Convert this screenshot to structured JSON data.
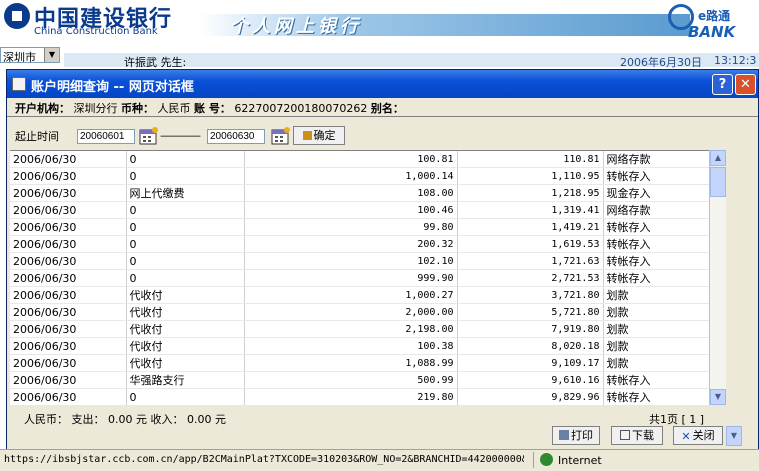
{
  "banner": {
    "bank_name": "中国建设银行",
    "bank_name_en": "China Construction Bank",
    "slogan": "个人网上银行",
    "ebank_cn": "e路通",
    "ebank_en": "BANK"
  },
  "location": {
    "city": "深圳市"
  },
  "user": {
    "name": "许振武 先生:",
    "date": "2006年6月30日",
    "time": "13:12:3"
  },
  "dialog": {
    "title": "账户明细查询 -- 网页对话框",
    "info": {
      "branch_label": "开户机构：",
      "branch_value": "深圳分行",
      "currency_label": "币种：",
      "currency_value": "人民币",
      "account_label": "账 号：",
      "account_value": "6227007200180070262",
      "alias_label": "别名："
    },
    "date_range": {
      "label": "起止时间",
      "start": "20060601",
      "separator": "————",
      "end": "20060630",
      "confirm_label": "确定"
    },
    "transactions": [
      {
        "date": "2006/06/30",
        "desc": "0",
        "extra": "",
        "amount": "100.81",
        "balance": "110.81",
        "type": "网络存款"
      },
      {
        "date": "2006/06/30",
        "desc": "0",
        "extra": "",
        "amount": "1,000.14",
        "balance": "1,110.95",
        "type": "转帐存入"
      },
      {
        "date": "2006/06/30",
        "desc": "网上代缴费",
        "extra": "",
        "amount": "108.00",
        "balance": "1,218.95",
        "type": "现金存入"
      },
      {
        "date": "2006/06/30",
        "desc": "0",
        "extra": "",
        "amount": "100.46",
        "balance": "1,319.41",
        "type": "网络存款"
      },
      {
        "date": "2006/06/30",
        "desc": "0",
        "extra": "",
        "amount": "99.80",
        "balance": "1,419.21",
        "type": "转帐存入"
      },
      {
        "date": "2006/06/30",
        "desc": "0",
        "extra": "",
        "amount": "200.32",
        "balance": "1,619.53",
        "type": "转帐存入"
      },
      {
        "date": "2006/06/30",
        "desc": "0",
        "extra": "",
        "amount": "102.10",
        "balance": "1,721.63",
        "type": "转帐存入"
      },
      {
        "date": "2006/06/30",
        "desc": "0",
        "extra": "",
        "amount": "999.90",
        "balance": "2,721.53",
        "type": "转帐存入"
      },
      {
        "date": "2006/06/30",
        "desc": "代收付",
        "extra": "",
        "amount": "1,000.27",
        "balance": "3,721.80",
        "type": "划款"
      },
      {
        "date": "2006/06/30",
        "desc": "代收付",
        "extra": "",
        "amount": "2,000.00",
        "balance": "5,721.80",
        "type": "划款"
      },
      {
        "date": "2006/06/30",
        "desc": "代收付",
        "extra": "",
        "amount": "2,198.00",
        "balance": "7,919.80",
        "type": "划款"
      },
      {
        "date": "2006/06/30",
        "desc": "代收付",
        "extra": "",
        "amount": "100.38",
        "balance": "8,020.18",
        "type": "划款"
      },
      {
        "date": "2006/06/30",
        "desc": "代收付",
        "extra": "",
        "amount": "1,088.99",
        "balance": "9,109.17",
        "type": "划款"
      },
      {
        "date": "2006/06/30",
        "desc": "华强路支行",
        "extra": "",
        "amount": "500.99",
        "balance": "9,610.16",
        "type": "转帐存入"
      },
      {
        "date": "2006/06/30",
        "desc": "0",
        "extra": "",
        "amount": "219.80",
        "balance": "9,829.96",
        "type": "转帐存入"
      }
    ],
    "summary": "人民币：  支出：  0.00 元     收入：  0.00 元",
    "pager": "共1页   [ 1 ]",
    "buttons": {
      "print": "打印",
      "download": "下载",
      "close": "关闭"
    }
  },
  "statusbar": {
    "url": "https://ibsbjstar.ccb.com.cn/app/B2CMainPlat?TXCODE=310203&ROW_NO=2&BRANCHID=442000000&",
    "zone": "Internet"
  }
}
